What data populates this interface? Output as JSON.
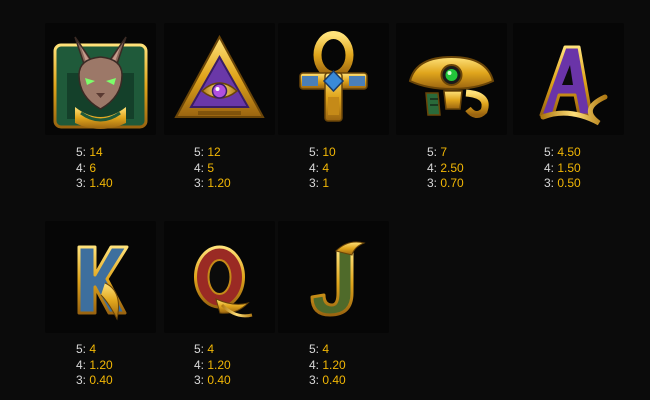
{
  "colors": {
    "background": "#0b0b0b",
    "tile": "#060606",
    "count_text": "#d9d9d9",
    "payout_text": "#f2b705"
  },
  "symbols": [
    {
      "icon": "cat-pharaoh-icon",
      "pays": [
        {
          "count": "5:",
          "value": "14"
        },
        {
          "count": "4:",
          "value": "6"
        },
        {
          "count": "3:",
          "value": "1.40"
        }
      ]
    },
    {
      "icon": "eye-pyramid-icon",
      "pays": [
        {
          "count": "5:",
          "value": "12"
        },
        {
          "count": "4:",
          "value": "5"
        },
        {
          "count": "3:",
          "value": "1.20"
        }
      ]
    },
    {
      "icon": "ankh-icon",
      "pays": [
        {
          "count": "5:",
          "value": "10"
        },
        {
          "count": "4:",
          "value": "4"
        },
        {
          "count": "3:",
          "value": "1"
        }
      ]
    },
    {
      "icon": "scarab-icon",
      "pays": [
        {
          "count": "5:",
          "value": "7"
        },
        {
          "count": "4:",
          "value": "2.50"
        },
        {
          "count": "3:",
          "value": "0.70"
        }
      ]
    },
    {
      "icon": "letter-a-icon",
      "letter": "A",
      "pays": [
        {
          "count": "5:",
          "value": "4.50"
        },
        {
          "count": "4:",
          "value": "1.50"
        },
        {
          "count": "3:",
          "value": "0.50"
        }
      ]
    },
    {
      "icon": "letter-k-icon",
      "letter": "K",
      "pays": [
        {
          "count": "5:",
          "value": "4"
        },
        {
          "count": "4:",
          "value": "1.20"
        },
        {
          "count": "3:",
          "value": "0.40"
        }
      ]
    },
    {
      "icon": "letter-q-icon",
      "letter": "Q",
      "pays": [
        {
          "count": "5:",
          "value": "4"
        },
        {
          "count": "4:",
          "value": "1.20"
        },
        {
          "count": "3:",
          "value": "0.40"
        }
      ]
    },
    {
      "icon": "letter-j-icon",
      "letter": "J",
      "pays": [
        {
          "count": "5:",
          "value": "4"
        },
        {
          "count": "4:",
          "value": "1.20"
        },
        {
          "count": "3:",
          "value": "0.40"
        }
      ]
    }
  ]
}
